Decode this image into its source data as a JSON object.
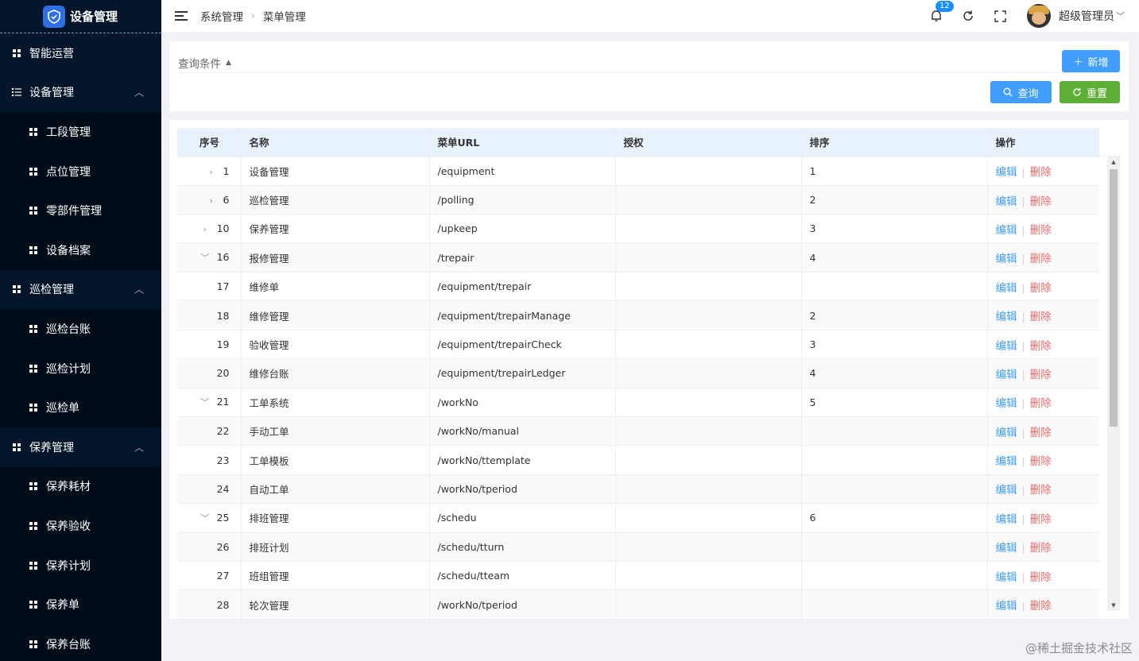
{
  "sidebar": {
    "title": "设备管理",
    "items": [
      {
        "label": "智能运营",
        "level": 1,
        "icon": "grid-icon"
      },
      {
        "label": "设备管理",
        "level": 1,
        "icon": "list-icon",
        "expanded": true
      },
      {
        "label": "工段管理",
        "level": 2,
        "icon": "grid-icon"
      },
      {
        "label": "点位管理",
        "level": 2,
        "icon": "grid-icon"
      },
      {
        "label": "零部件管理",
        "level": 2,
        "icon": "grid-icon"
      },
      {
        "label": "设备档案",
        "level": 2,
        "icon": "grid-icon"
      },
      {
        "label": "巡检管理",
        "level": 1,
        "icon": "grid-icon",
        "expanded": true
      },
      {
        "label": "巡检台账",
        "level": 2,
        "icon": "grid-icon"
      },
      {
        "label": "巡检计划",
        "level": 2,
        "icon": "grid-icon"
      },
      {
        "label": "巡检单",
        "level": 2,
        "icon": "grid-icon"
      },
      {
        "label": "保养管理",
        "level": 1,
        "icon": "grid-icon",
        "expanded": true
      },
      {
        "label": "保养耗材",
        "level": 2,
        "icon": "grid-icon"
      },
      {
        "label": "保养验收",
        "level": 2,
        "icon": "grid-icon"
      },
      {
        "label": "保养计划",
        "level": 2,
        "icon": "grid-icon"
      },
      {
        "label": "保养单",
        "level": 2,
        "icon": "grid-icon"
      },
      {
        "label": "保养台账",
        "level": 2,
        "icon": "grid-icon"
      }
    ]
  },
  "header": {
    "breadcrumb": [
      "系统管理",
      "菜单管理"
    ],
    "notification_count": "12",
    "user_name": "超级管理员"
  },
  "query": {
    "title": "查询条件",
    "add_label": "新增",
    "search_label": "查询",
    "reset_label": "重置"
  },
  "table": {
    "columns": [
      "序号",
      "名称",
      "菜单URL",
      "授权",
      "排序",
      "操作"
    ],
    "edit_label": "编辑",
    "delete_label": "删除",
    "rows": [
      {
        "id": "1",
        "toggle": "collapsed",
        "name": "设备管理",
        "url": "/equipment",
        "auth": "",
        "sort": "1"
      },
      {
        "id": "6",
        "toggle": "collapsed",
        "name": "巡检管理",
        "url": "/polling",
        "auth": "",
        "sort": "2"
      },
      {
        "id": "10",
        "toggle": "collapsed",
        "name": "保养管理",
        "url": "/upkeep",
        "auth": "",
        "sort": "3"
      },
      {
        "id": "16",
        "toggle": "expanded",
        "name": "报修管理",
        "url": "/trepair",
        "auth": "",
        "sort": "4"
      },
      {
        "id": "17",
        "toggle": "",
        "name": "维修单",
        "url": "/equipment/trepair",
        "auth": "",
        "sort": ""
      },
      {
        "id": "18",
        "toggle": "",
        "name": "维修管理",
        "url": "/equipment/trepairManage",
        "auth": "",
        "sort": "2"
      },
      {
        "id": "19",
        "toggle": "",
        "name": "验收管理",
        "url": "/equipment/trepairCheck",
        "auth": "",
        "sort": "3"
      },
      {
        "id": "20",
        "toggle": "",
        "name": "维修台账",
        "url": "/equipment/trepairLedger",
        "auth": "",
        "sort": "4"
      },
      {
        "id": "21",
        "toggle": "expanded",
        "name": "工单系统",
        "url": "/workNo",
        "auth": "",
        "sort": "5"
      },
      {
        "id": "22",
        "toggle": "",
        "name": "手动工单",
        "url": "/workNo/manual",
        "auth": "",
        "sort": ""
      },
      {
        "id": "23",
        "toggle": "",
        "name": "工单模板",
        "url": "/workNo/ttemplate",
        "auth": "",
        "sort": ""
      },
      {
        "id": "24",
        "toggle": "",
        "name": "自动工单",
        "url": "/workNo/tperiod",
        "auth": "",
        "sort": ""
      },
      {
        "id": "25",
        "toggle": "expanded",
        "name": "排班管理",
        "url": "/schedu",
        "auth": "",
        "sort": "6"
      },
      {
        "id": "26",
        "toggle": "",
        "name": "排班计划",
        "url": "/schedu/tturn",
        "auth": "",
        "sort": ""
      },
      {
        "id": "27",
        "toggle": "",
        "name": "班组管理",
        "url": "/schedu/tteam",
        "auth": "",
        "sort": ""
      },
      {
        "id": "28",
        "toggle": "",
        "name": "轮次管理",
        "url": "/workNo/tperiod",
        "auth": "",
        "sort": ""
      }
    ]
  },
  "watermark": "@稀土掘金技术社区",
  "colors": {
    "sidebar_bg": "#001529",
    "primary": "#409eff",
    "success": "#5daf34",
    "danger": "#f56c6c"
  }
}
